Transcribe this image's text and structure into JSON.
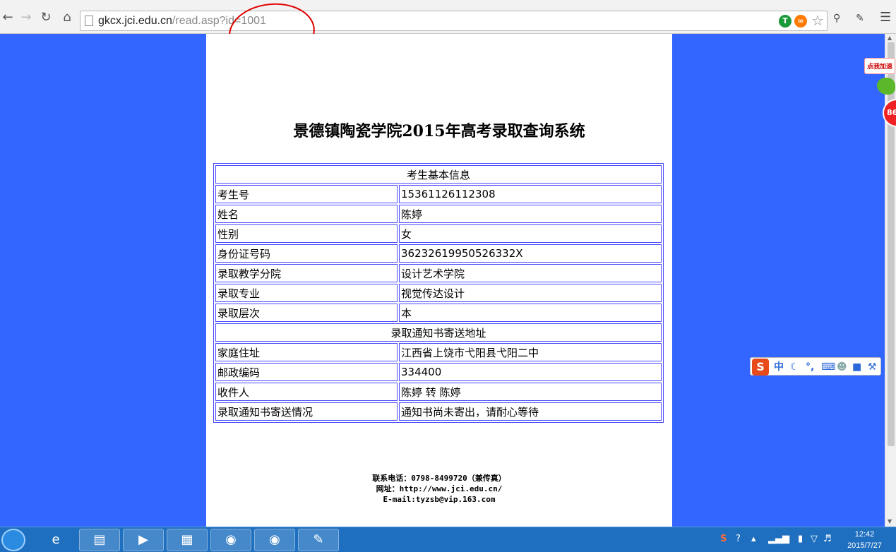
{
  "browser": {
    "url_host": "gkcx.jci.edu.cn",
    "url_path": "/read.asp?id=1001",
    "icons": [
      "back-icon",
      "forward-icon",
      "reload-icon",
      "home-icon",
      "page-icon",
      "star-icon",
      "menu-icon"
    ]
  },
  "page": {
    "title": "景德镇陶瓷学院2015年高考录取查询系统",
    "sections": {
      "basic": "考生基本信息",
      "mail": "录取通知书寄送地址"
    },
    "basic_rows": [
      {
        "label": "考生号",
        "value": "15361126112308"
      },
      {
        "label": "姓名",
        "value": "陈婷"
      },
      {
        "label": "性别",
        "value": "女"
      },
      {
        "label": "身份证号码",
        "value": "36232619950526332X"
      },
      {
        "label": "录取教学分院",
        "value": "设计艺术学院"
      },
      {
        "label": "录取专业",
        "value": "视觉传达设计"
      },
      {
        "label": "录取层次",
        "value": "本"
      }
    ],
    "mail_rows": [
      {
        "label": "家庭住址",
        "value": "江西省上饶市弋阳县弋阳二中"
      },
      {
        "label": "邮政编码",
        "value": "334400"
      },
      {
        "label": "收件人",
        "value": "陈婷 转 陈婷"
      },
      {
        "label": "录取通知书寄送情况",
        "value": "通知书尚未寄出，请耐心等待"
      }
    ],
    "footer": {
      "phone": "联系电话：0798-8499720（兼传真）",
      "site": "网址：http://www.jci.edu.cn/",
      "email": "E-mail:tyzsb@vip.163.com"
    }
  },
  "widgets": {
    "accelerator_label": "点我加速",
    "accelerator_badge": "86",
    "ime_logo": "S",
    "ime_mode": "中"
  },
  "taskbar": {
    "time": "12:42",
    "date": "2015/7/27"
  },
  "colors": {
    "page_bg": "#3366ff",
    "table_border": "#4a4aff",
    "annotation": "#e00000"
  }
}
